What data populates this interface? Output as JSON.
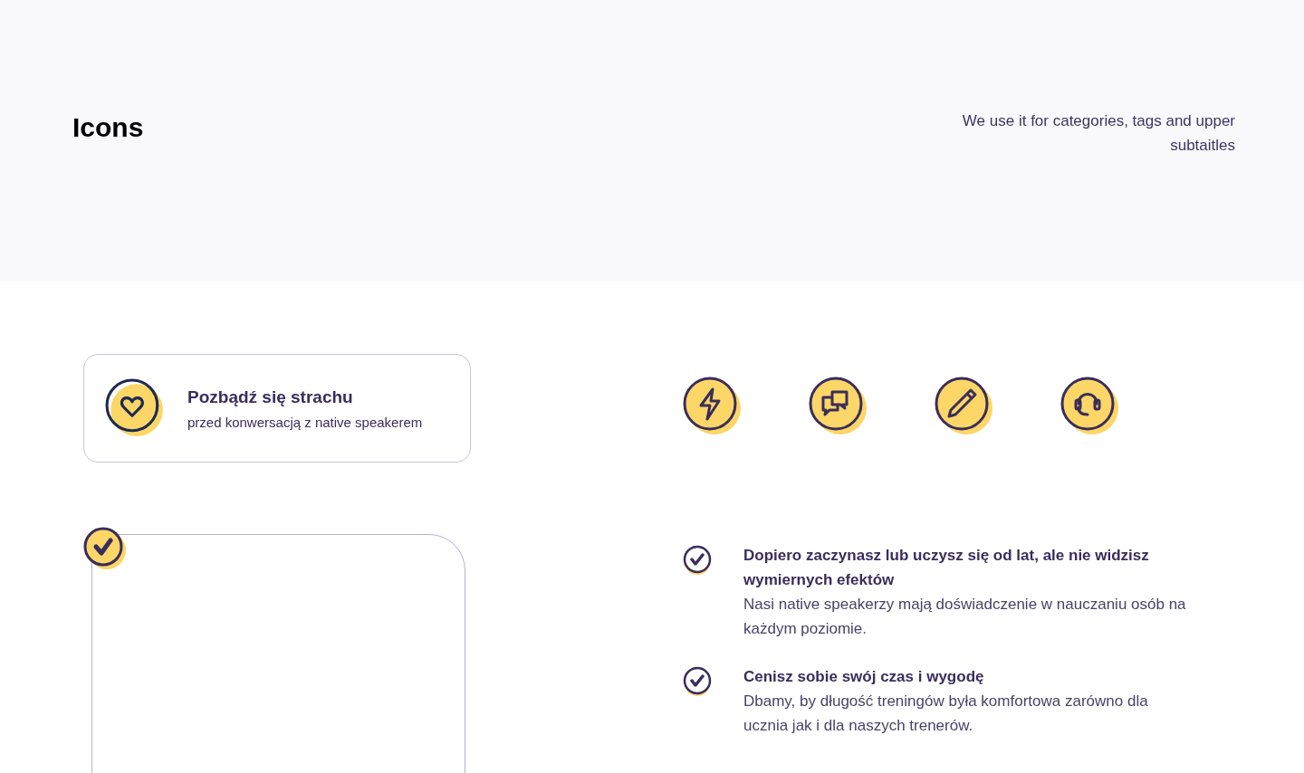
{
  "header": {
    "title": "Icons",
    "description": "We use it for categories, tags and upper subtaitles"
  },
  "feature_card": {
    "title": "Pozbądź się strachu",
    "subtitle": "przed konwersacją z native speakerem"
  },
  "checklist": [
    {
      "title": "Dopiero zaczynasz lub uczysz się od lat, ale nie widzisz wymiernych efektów",
      "text": "Nasi native speakerzy mają doświadczenie w nauczaniu osób na każdym poziomie."
    },
    {
      "title": "Cenisz sobie swój czas i wygodę",
      "text": "Dbamy, by długość treningów była komfortowa zarówno dla ucznia jak i dla naszych trenerów."
    }
  ]
}
